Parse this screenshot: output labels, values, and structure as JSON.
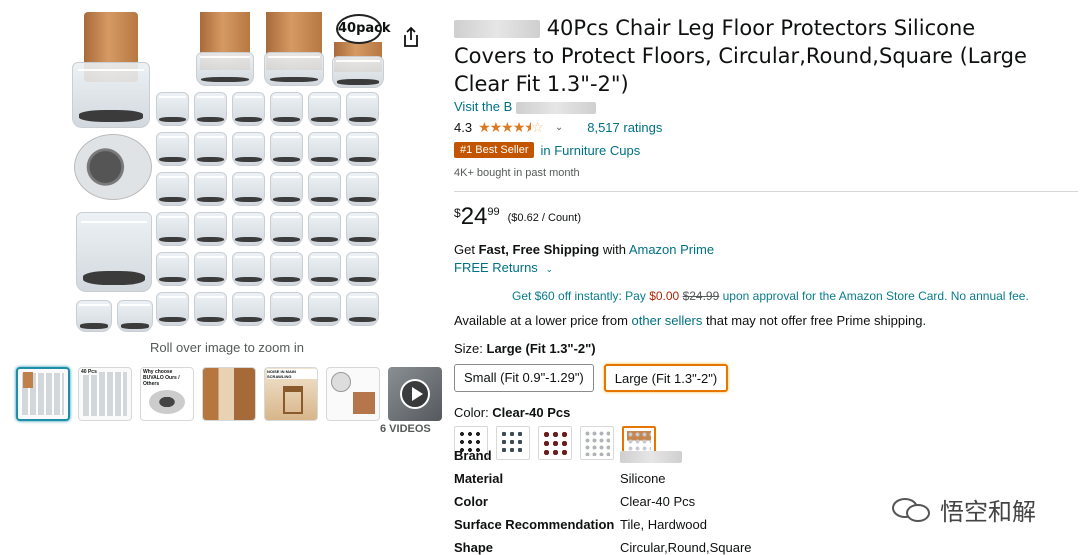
{
  "gallery": {
    "pack_badge": "40pack",
    "zoom_hint": "Roll over image to zoom in",
    "videos_label": "6 VIDEOS",
    "thumb_texts": [
      "40 Pcs",
      "Why choose BUVALO Ours / Others",
      "NOISE IN MAIN SCRAWLING"
    ]
  },
  "product": {
    "title_visible": "40Pcs Chair Leg Floor Protectors Silicone Covers to Protect Floors, Circular,Round,Square (Large Clear Fit 1.3\"-2\")",
    "store_prefix": "Visit the B",
    "rating_value": "4.3",
    "ratings_count": "8,517 ratings",
    "bestseller_badge": "#1 Best Seller",
    "bestseller_category": "in Furniture Cups",
    "bought": "4K+ bought in past month",
    "price_symbol": "$",
    "price_whole": "24",
    "price_fraction": "99",
    "unit_price": "($0.62 / Count)",
    "shipping_prefix": "Get ",
    "shipping_bold": "Fast, Free Shipping",
    "shipping_with": " with ",
    "shipping_prime": "Amazon Prime",
    "returns": "FREE Returns",
    "promo_a": "Get $60 off instantly: Pay ",
    "promo_pay": "$0.00",
    "promo_strike": "$24.99",
    "promo_b": " upon approval for the Amazon Store Card. No annual fee.",
    "lower_a": "Available at a lower price from ",
    "lower_link": "other sellers",
    "lower_b": " that may not offer free Prime shipping.",
    "size_prefix": "Size: ",
    "size_selected": "Large (Fit 1.3\"-2\")",
    "sizes": [
      "Small (Fit 0.9\"-1.29\")",
      "Large (Fit 1.3\"-2\")"
    ],
    "color_prefix": "Color: ",
    "color_selected": "Clear-40 Pcs"
  },
  "specs": [
    {
      "key": "Brand",
      "value": ""
    },
    {
      "key": "Material",
      "value": "Silicone"
    },
    {
      "key": "Color",
      "value": "Clear-40 Pcs"
    },
    {
      "key": "Surface Recommendation",
      "value": "Tile, Hardwood"
    },
    {
      "key": "Shape",
      "value": "Circular,Round,Square"
    }
  ],
  "watermark": "悟空和解",
  "colors": {
    "link": "#007185",
    "badge": "#c45500",
    "star": "#de7921",
    "selected": "#e77600"
  }
}
